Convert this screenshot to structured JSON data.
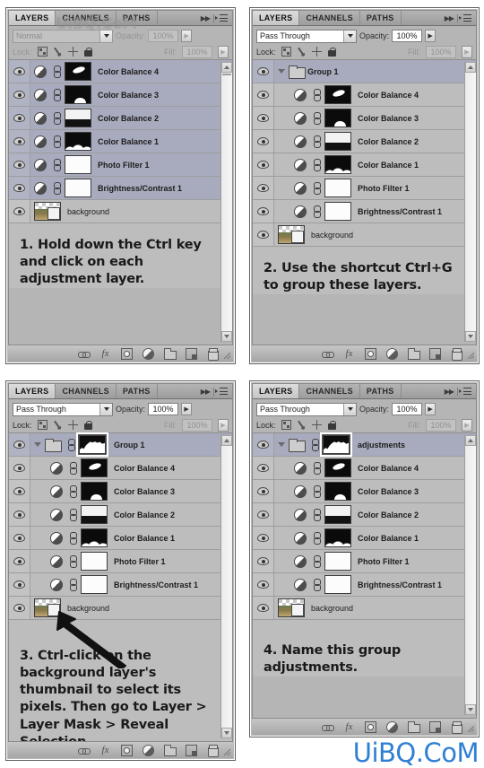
{
  "panels": [
    {
      "id": "step1",
      "tabs": [
        {
          "label": "LAYERS",
          "active": true
        },
        {
          "label": "CHANNELS",
          "active": false
        },
        {
          "label": "PATHS",
          "active": false
        }
      ],
      "blend_mode": "Normal",
      "blend_dim": true,
      "opacity_label": "Opacity:",
      "opacity_value": "100%",
      "opacity_dim": true,
      "lock_label": "Lock:",
      "fill_label": "Fill:",
      "fill_value": "100%",
      "layers": [
        {
          "name": "Color Balance 4",
          "type": "adjustment",
          "selected": true,
          "indent": false,
          "thumb": "blob"
        },
        {
          "name": "Color Balance 3",
          "type": "adjustment",
          "selected": true,
          "indent": false,
          "thumb": "hill"
        },
        {
          "name": "Color Balance 2",
          "type": "adjustment",
          "selected": true,
          "indent": false,
          "thumb": "mtn-light"
        },
        {
          "name": "Color Balance 1",
          "type": "adjustment",
          "selected": true,
          "indent": false,
          "thumb": "mtn-dark"
        },
        {
          "name": "Photo Filter 1",
          "type": "adjustment",
          "selected": true,
          "indent": false,
          "thumb": "white"
        },
        {
          "name": "Brightness/Contrast 1",
          "type": "adjustment",
          "selected": true,
          "indent": false,
          "thumb": "white"
        },
        {
          "name": "background",
          "type": "background",
          "selected": false,
          "indent": false,
          "thumb": "photo"
        }
      ],
      "instruction": "1. Hold down the Ctrl key and click on each adjustment layer.",
      "arrow": false
    },
    {
      "id": "step2",
      "tabs": [
        {
          "label": "LAYERS",
          "active": true
        },
        {
          "label": "CHANNELS",
          "active": false
        },
        {
          "label": "PATHS",
          "active": false
        }
      ],
      "blend_mode": "Pass Through",
      "blend_dim": false,
      "opacity_label": "Opacity:",
      "opacity_value": "100%",
      "opacity_dim": false,
      "lock_label": "Lock:",
      "fill_label": "Fill:",
      "fill_value": "100%",
      "layers": [
        {
          "name": "Group 1",
          "type": "group",
          "selected": true,
          "indent": false,
          "thumb": "none"
        },
        {
          "name": "Color Balance 4",
          "type": "adjustment",
          "selected": false,
          "indent": true,
          "thumb": "blob"
        },
        {
          "name": "Color Balance 3",
          "type": "adjustment",
          "selected": false,
          "indent": true,
          "thumb": "hill"
        },
        {
          "name": "Color Balance 2",
          "type": "adjustment",
          "selected": false,
          "indent": true,
          "thumb": "mtn-light"
        },
        {
          "name": "Color Balance 1",
          "type": "adjustment",
          "selected": false,
          "indent": true,
          "thumb": "mtn-dark"
        },
        {
          "name": "Photo Filter 1",
          "type": "adjustment",
          "selected": false,
          "indent": true,
          "thumb": "white"
        },
        {
          "name": "Brightness/Contrast 1",
          "type": "adjustment",
          "selected": false,
          "indent": true,
          "thumb": "white"
        },
        {
          "name": "background",
          "type": "background",
          "selected": false,
          "indent": false,
          "thumb": "photo"
        }
      ],
      "instruction": "2. Use the shortcut Ctrl+G to group these layers.",
      "arrow": false
    },
    {
      "id": "step3",
      "tabs": [
        {
          "label": "LAYERS",
          "active": true
        },
        {
          "label": "CHANNELS",
          "active": false
        },
        {
          "label": "PATHS",
          "active": false
        }
      ],
      "blend_mode": "Pass Through",
      "blend_dim": false,
      "opacity_label": "Opacity:",
      "opacity_value": "100%",
      "opacity_dim": false,
      "lock_label": "Lock:",
      "fill_label": "Fill:",
      "fill_value": "100%",
      "layers": [
        {
          "name": "Group 1",
          "type": "group-masked",
          "selected": true,
          "indent": false,
          "thumb": "hist"
        },
        {
          "name": "Color Balance 4",
          "type": "adjustment",
          "selected": false,
          "indent": true,
          "thumb": "blob"
        },
        {
          "name": "Color Balance 3",
          "type": "adjustment",
          "selected": false,
          "indent": true,
          "thumb": "hill"
        },
        {
          "name": "Color Balance 2",
          "type": "adjustment",
          "selected": false,
          "indent": true,
          "thumb": "mtn-light"
        },
        {
          "name": "Color Balance 1",
          "type": "adjustment",
          "selected": false,
          "indent": true,
          "thumb": "mtn-dark"
        },
        {
          "name": "Photo Filter 1",
          "type": "adjustment",
          "selected": false,
          "indent": true,
          "thumb": "white"
        },
        {
          "name": "Brightness/Contrast 1",
          "type": "adjustment",
          "selected": false,
          "indent": true,
          "thumb": "white"
        },
        {
          "name": "background",
          "type": "background",
          "selected": false,
          "indent": false,
          "thumb": "photo"
        }
      ],
      "instruction": "3. Ctrl-click on the background layer's thumbnail to select its pixels. Then go to Layer > Layer Mask > Reveal Selection.",
      "arrow": true
    },
    {
      "id": "step4",
      "tabs": [
        {
          "label": "LAYERS",
          "active": true
        },
        {
          "label": "CHANNELS",
          "active": false
        },
        {
          "label": "PATHS",
          "active": false
        }
      ],
      "blend_mode": "Pass Through",
      "blend_dim": false,
      "opacity_label": "Opacity:",
      "opacity_value": "100%",
      "opacity_dim": false,
      "lock_label": "Lock:",
      "fill_label": "Fill:",
      "fill_value": "100%",
      "layers": [
        {
          "name": "adjustments",
          "type": "group-masked",
          "selected": true,
          "indent": false,
          "thumb": "hist"
        },
        {
          "name": "Color Balance 4",
          "type": "adjustment",
          "selected": false,
          "indent": true,
          "thumb": "blob"
        },
        {
          "name": "Color Balance 3",
          "type": "adjustment",
          "selected": false,
          "indent": true,
          "thumb": "hill"
        },
        {
          "name": "Color Balance 2",
          "type": "adjustment",
          "selected": false,
          "indent": true,
          "thumb": "mtn-light"
        },
        {
          "name": "Color Balance 1",
          "type": "adjustment",
          "selected": false,
          "indent": true,
          "thumb": "mtn-dark"
        },
        {
          "name": "Photo Filter 1",
          "type": "adjustment",
          "selected": false,
          "indent": true,
          "thumb": "white"
        },
        {
          "name": "Brightness/Contrast 1",
          "type": "adjustment",
          "selected": false,
          "indent": true,
          "thumb": "white"
        },
        {
          "name": "background",
          "type": "background",
          "selected": false,
          "indent": false,
          "thumb": "photo"
        }
      ],
      "instruction": "4. Name this group adjustments.",
      "arrow": false
    }
  ],
  "toolbar_icons": [
    "link-icon",
    "fx-icon",
    "layer-mask-icon",
    "adjustment-icon",
    "new-group-icon",
    "new-layer-icon",
    "trash-icon"
  ],
  "fx_glyph": "fx",
  "watermark": {
    "text": "UiBQ.CoM",
    "color": "#2f7fd4",
    "faint_text": "UiBQ.CoM"
  },
  "colors": {
    "panel_bg": "#b5b5b5",
    "row_bg": "#bdbdbd",
    "row_selected": "#a8abbd",
    "tab_active": "#dcdcdc",
    "text": "#1c1c1c",
    "watermark_blue": "#2f7fd4"
  }
}
